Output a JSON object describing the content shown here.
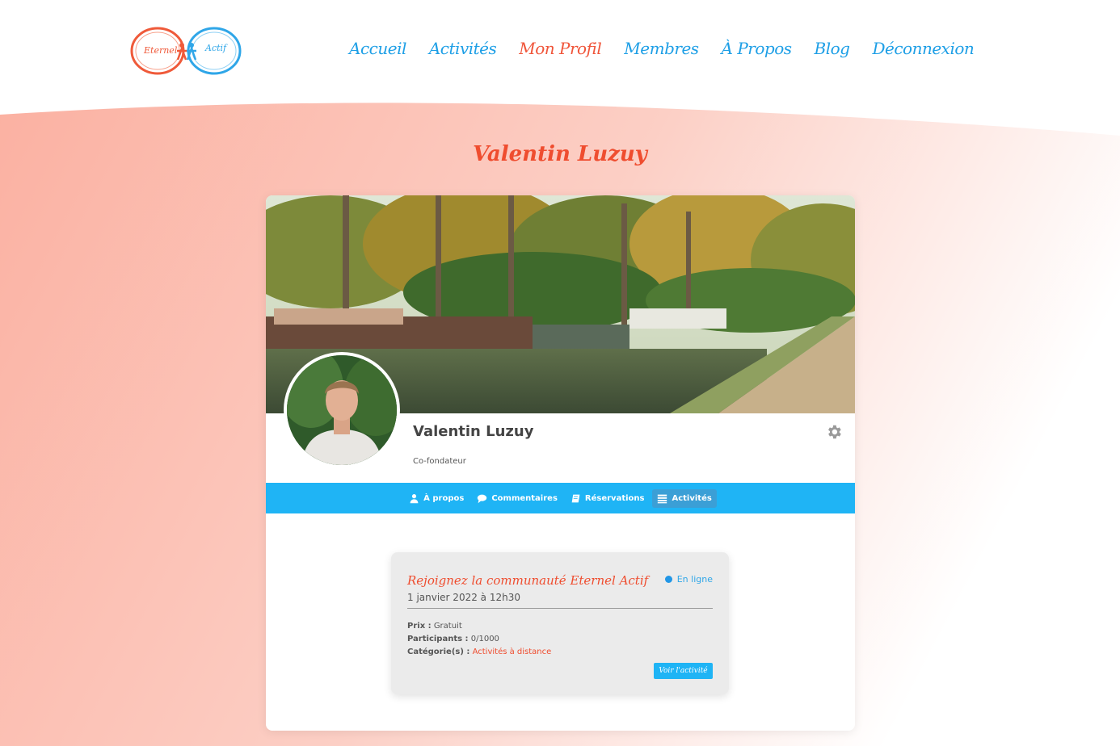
{
  "brand": {
    "logo_left": "Eternel",
    "logo_right": "Actif",
    "colors": {
      "primary_blue": "#1fb4f5",
      "accent_red": "#ef4d2f",
      "background_pink": "#fbb8aa"
    }
  },
  "nav": {
    "items": [
      {
        "label": "Accueil",
        "active": false
      },
      {
        "label": "Activités",
        "active": false
      },
      {
        "label": "Mon Profil",
        "active": true
      },
      {
        "label": "Membres",
        "active": false
      },
      {
        "label": "À Propos",
        "active": false
      },
      {
        "label": "Blog",
        "active": false
      },
      {
        "label": "Déconnexion",
        "active": false
      }
    ]
  },
  "page": {
    "title": "Valentin Luzuy"
  },
  "profile": {
    "name": "Valentin Luzuy",
    "role": "Co-fondateur",
    "settings_icon": "gear-icon"
  },
  "tabs": [
    {
      "label": "À propos",
      "icon": "user-icon",
      "active": false
    },
    {
      "label": "Commentaires",
      "icon": "comment-icon",
      "active": false
    },
    {
      "label": "Réservations",
      "icon": "book-icon",
      "active": false
    },
    {
      "label": "Activités",
      "icon": "list-icon",
      "active": true
    }
  ],
  "activity": {
    "title": "Rejoignez la communauté Eternel Actif",
    "status": "En ligne",
    "date": "1 janvier 2022 à 12h30",
    "price_label": "Prix :",
    "price_value": "Gratuit",
    "participants_label": "Participants :",
    "participants_value": "0/1000",
    "category_label": "Catégorie(s) :",
    "category_value": "Activités à distance",
    "button_label": "Voir l'activité"
  }
}
